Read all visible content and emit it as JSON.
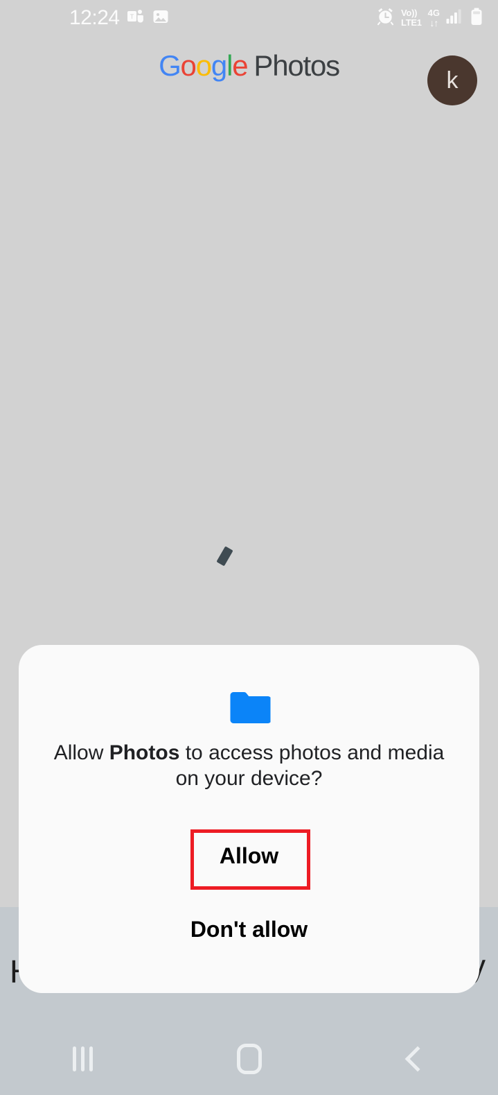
{
  "status_bar": {
    "time": "12:24",
    "icons_left": [
      "teams-icon",
      "gallery-icon"
    ],
    "alarm_icon": "alarm-clock-icon",
    "volte_line1": "Vo))",
    "volte_line2": "LTE1",
    "network_type": "4G",
    "network_arrows": "↓↑",
    "signal_icon": "signal-bars-icon",
    "battery_icon": "battery-icon"
  },
  "app_header": {
    "brand_google": "Google",
    "brand_suffix": "Photos",
    "google_letters": [
      {
        "char": "G",
        "color": "#4285F4"
      },
      {
        "char": "o",
        "color": "#EA4335"
      },
      {
        "char": "o",
        "color": "#FBBC05"
      },
      {
        "char": "g",
        "color": "#4285F4"
      },
      {
        "char": "l",
        "color": "#34A853"
      },
      {
        "char": "e",
        "color": "#EA4335"
      }
    ],
    "avatar_initial": "k",
    "avatar_color": "#4a372e"
  },
  "background_fragments": {
    "left": "H",
    "right": "y"
  },
  "dialog": {
    "icon": "folder-icon",
    "icon_color": "#0b84f8",
    "title_prefix": "Allow ",
    "title_app": "Photos",
    "title_suffix": " to access photos and media on your device?",
    "allow_label": "Allow",
    "deny_label": "Don't allow"
  },
  "annotation": {
    "highlight_target": "Allow",
    "highlight_color": "#ed1c24"
  },
  "nav_bar": {
    "recents_label": "Recents",
    "home_label": "Home",
    "back_label": "Back"
  },
  "colors": {
    "background_upper": "#d2d2d2",
    "background_lower": "#c3c9ce",
    "dialog_surface": "#fafafa",
    "text_primary": "#202124"
  }
}
